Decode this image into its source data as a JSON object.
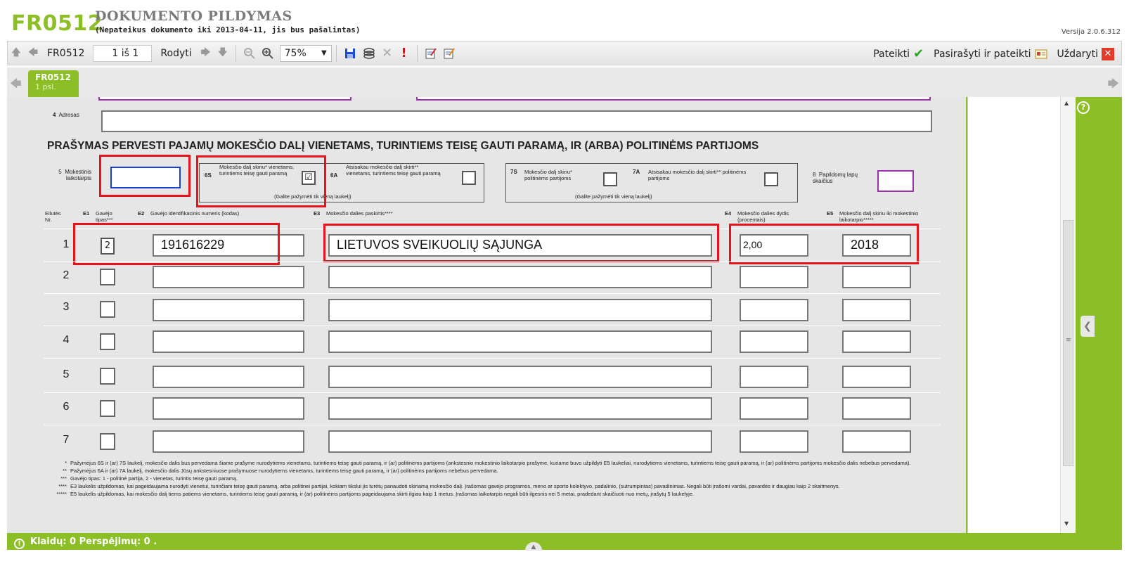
{
  "header": {
    "code": "FR0512",
    "title": "DOKUMENTO PILDYMAS",
    "subtitle": "(Nepateikus dokumento iki 2013-04-11, jis bus pašalintas)",
    "version": "Versija 2.0.6.312"
  },
  "toolbar": {
    "doc_code": "FR0512",
    "page_indicator": "1 iš 1",
    "show_label": "Rodyti",
    "zoom": "75%",
    "submit_label": "Pateikti",
    "sign_submit_label": "Pasirašyti ir pateikti",
    "close_label": "Uždaryti"
  },
  "tab": {
    "name": "FR0512",
    "page": "1 psl."
  },
  "form": {
    "address_label_num": "4",
    "address_label": "Adresas",
    "heading": "PRAŠYMAS PERVESTI PAJAMŲ MOKESČIO DALĮ VIENETAMS, TURINTIEMS TEISĘ GAUTI PARAMĄ, IR (ARBA) POLITINĖMS PARTIJOMS",
    "tax_period_num": "5",
    "tax_period_label": "Mokestinis laikotarpis",
    "tax_period_value": "",
    "opt6s_code": "6S",
    "opt6s_label": "Mokesčio dalį skiriu* vienetams, turintiems teisę gauti paramą",
    "opt6s_checked": "☑",
    "opt6a_code": "6A",
    "opt6a_label": "Atsisakau mokesčio dalį skirti** vienetams, turintiems teisę gauti paramą",
    "opt6_note": "(Galite pažymėti tik vieną laukelį)",
    "opt7s_code": "7S",
    "opt7s_label": "Mokesčio dalį skiriu* politinėms partijoms",
    "opt7a_code": "7A",
    "opt7a_label": "Atsisakau mokesčio dalį skirti** politinėms partijoms",
    "opt7_note": "(Galite pažymėti tik vieną laukelį)",
    "extra_pages_num": "8",
    "extra_pages_label": "Papildomų lapų skaičius",
    "col_row_label": "Eilutės Nr.",
    "col_e1_code": "E1",
    "col_e1_label": "Gavėjo tipas***",
    "col_e2_code": "E2",
    "col_e2_label": "Gavėjo identifikacinis numeris (kodas)",
    "col_e3_code": "E3",
    "col_e3_label": "Mokesčio dalies paskirtis****",
    "col_e4_code": "E4",
    "col_e4_label": "Mokesčio dalies dydis (procentais)",
    "col_e5_code": "E5",
    "col_e5_label": "Mokesčio dalį skiriu iki mokestinio laikotarpio*****",
    "rows": [
      {
        "num": "1",
        "e1": "2",
        "e2": "191616229",
        "e3": "LIETUVOS SVEIKUOLIŲ SĄJUNGA",
        "e4": "2,00",
        "e5": "2018"
      },
      {
        "num": "2",
        "e1": "",
        "e2": "",
        "e3": "",
        "e4": "",
        "e5": ""
      },
      {
        "num": "3",
        "e1": "",
        "e2": "",
        "e3": "",
        "e4": "",
        "e5": ""
      },
      {
        "num": "4",
        "e1": "",
        "e2": "",
        "e3": "",
        "e4": "",
        "e5": ""
      },
      {
        "num": "5",
        "e1": "",
        "e2": "",
        "e3": "",
        "e4": "",
        "e5": ""
      },
      {
        "num": "6",
        "e1": "",
        "e2": "",
        "e3": "",
        "e4": "",
        "e5": ""
      },
      {
        "num": "7",
        "e1": "",
        "e2": "",
        "e3": "",
        "e4": "",
        "e5": ""
      }
    ],
    "footnotes": [
      {
        "mark": "*",
        "text": "Pažymėjus 6S ir (ar) 7S laukelį, mokesčio dalis bus pervedama šiame prašyme nurodytiems vienetams, turintiems teisę gauti paramą, ir (ar) politinėms partijoms (ankstesnio mokestinio laikotarpio prašyme, kuriame buvo užpildyti E5 laukeliai, nurodytiems vienetams, turintiems teisę gauti paramą, ir (ar) politinėms partijoms mokesčio dalis nebebus pervedama)."
      },
      {
        "mark": "**",
        "text": "Pažymėjus 6A ir (ar) 7A laukelį, mokesčio dalis Jūsų ankstesniuose prašymuose nurodytiems vienetams, turintiems teisę gauti paramą, ir (ar) politinėms partijoms nebebus pervedama."
      },
      {
        "mark": "***",
        "text": "Gavėjo tipas: 1 - politinė partija, 2 - vienetas, turintis teisę gauti paramą."
      },
      {
        "mark": "****",
        "text": "E3 laukelis užpildomas, kai pageidaujama nurodyti vienetui, turinčiam teisę gauti paramą, arba politinei partijai, kokiam tikslui jis turėtų panaudoti skiriamą mokesčio dalį. Įrašomas gavėjo programos, meno ar sporto kolektyvo, padalinio, (sutrumpintas) pavadinimas. Negali būti įrašomi vardai, pavardės ir daugiau kaip 2 skaitmenys."
      },
      {
        "mark": "*****",
        "text": "E5 laukelis užpildomas, kai mokesčio dalį tiems patiems vienetams, turintiems teisę gauti paramą, ir (ar) politinėms partijoms pageidaujama skirti ilgiau kaip 1 metus. Įrašomas laikotarpis negali būti ilgesnis nei 5 metai, pradedant skaičiuoti nuo metų, įrašytų 5 laukelyje."
      }
    ]
  },
  "status": {
    "text": "Klaidų: 0 Perspėjimų: 0 ."
  },
  "colors": {
    "accent": "#8cbf26",
    "highlight": "#e8121b",
    "field_border_blue": "#1a3fd6",
    "field_border_purple": "#9b2fae"
  },
  "icons": [
    "arrow-up-icon",
    "arrow-left-icon",
    "arrow-right-icon",
    "arrow-down-icon",
    "zoom-out-icon",
    "zoom-in-icon",
    "save-icon",
    "stack-icon",
    "delete-icon",
    "exclamation-icon",
    "edit-icon",
    "edit-check-icon",
    "checkmark-icon",
    "sign-card-icon",
    "close-icon",
    "help-icon",
    "warning-icon"
  ]
}
